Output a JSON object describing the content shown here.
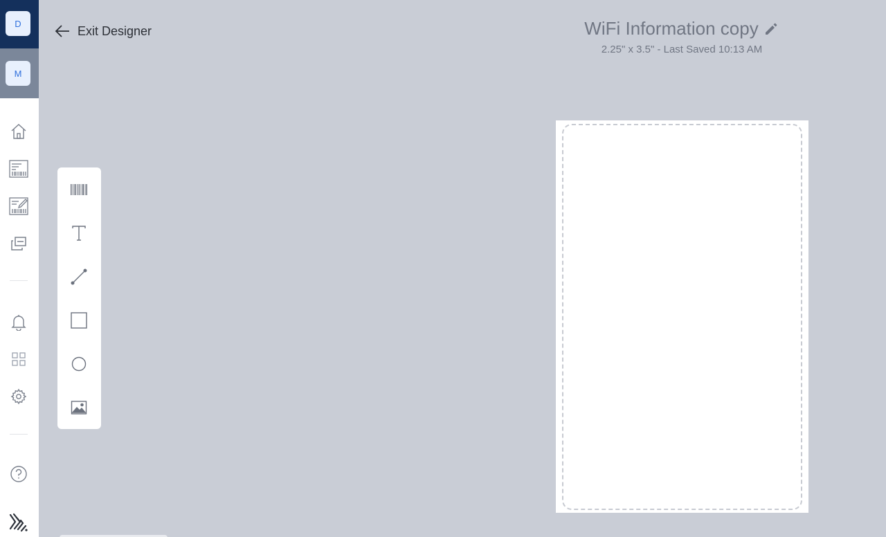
{
  "nav": {
    "avatars": [
      {
        "letter": "D"
      },
      {
        "letter": "M"
      }
    ],
    "items": [
      {
        "icon": "home-icon"
      },
      {
        "icon": "label-templates-icon"
      },
      {
        "icon": "label-designer-icon"
      },
      {
        "icon": "copy-icon"
      },
      {
        "icon": "bell-icon"
      },
      {
        "icon": "apps-grid-icon"
      },
      {
        "icon": "gear-icon"
      },
      {
        "icon": "help-icon"
      },
      {
        "icon": "zebra-logo-icon"
      }
    ]
  },
  "header": {
    "exit_label": "Exit Designer",
    "title": "WiFi Information copy",
    "subtitle": "2.25\" x 3.5\" - Last Saved 10:13 AM"
  },
  "tools": [
    {
      "icon": "barcode-tool-icon"
    },
    {
      "icon": "text-tool-icon"
    },
    {
      "icon": "line-tool-icon"
    },
    {
      "icon": "rectangle-tool-icon"
    },
    {
      "icon": "ellipse-tool-icon"
    },
    {
      "icon": "image-tool-icon"
    }
  ],
  "colors": {
    "workspace": "#c9cdd6",
    "nav_top": "#14305c",
    "nav_user": "#7b879a",
    "accent": "#2f6fdc"
  }
}
